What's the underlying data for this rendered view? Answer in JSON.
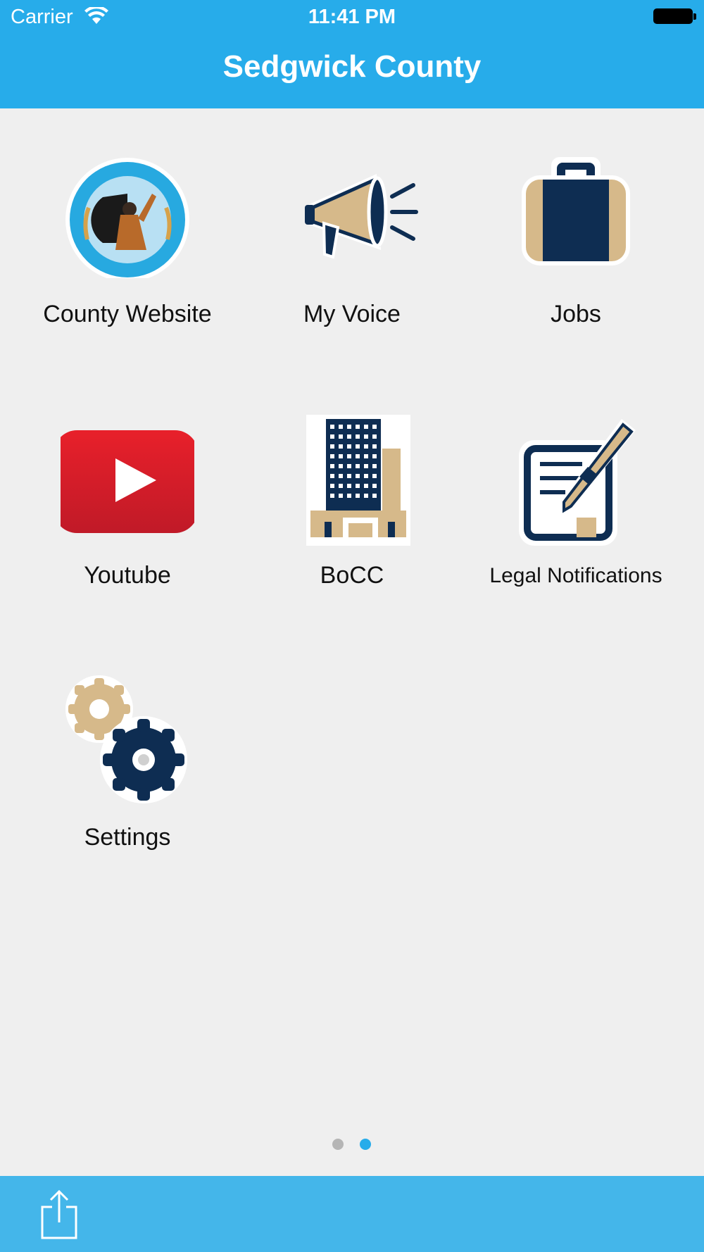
{
  "status_bar": {
    "carrier": "Carrier",
    "time": "11:41 PM",
    "wifi_icon": "wifi-icon",
    "battery_icon": "battery-icon"
  },
  "header": {
    "title": "Sedgwick County",
    "color": "#27acea"
  },
  "tiles": [
    {
      "label": "County Website",
      "icon": "county-seal-icon"
    },
    {
      "label": "My Voice",
      "icon": "megaphone-icon"
    },
    {
      "label": "Jobs",
      "icon": "briefcase-icon"
    },
    {
      "label": "Youtube",
      "icon": "youtube-icon"
    },
    {
      "label": "BoCC",
      "icon": "building-icon"
    },
    {
      "label": "Legal Notifications",
      "icon": "document-pen-icon"
    },
    {
      "label": "Settings",
      "icon": "gears-icon"
    }
  ],
  "page_indicator": {
    "count": 2,
    "current": 2,
    "active_color": "#27acea",
    "inactive_color": "#b5b5b5"
  },
  "footer": {
    "share_icon": "share-icon"
  },
  "colors": {
    "navy": "#0e2d52",
    "tan": "#d6b98a",
    "red": "#e0202a"
  }
}
